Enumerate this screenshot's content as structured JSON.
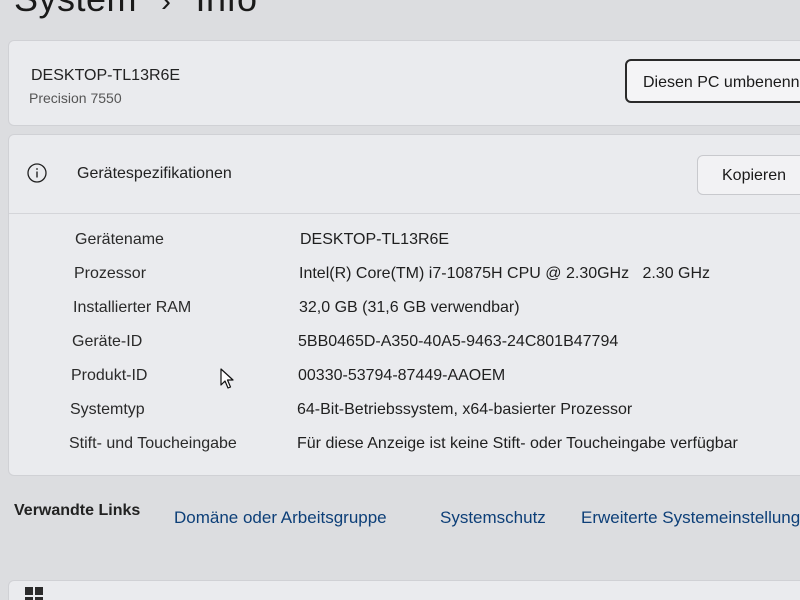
{
  "breadcrumb": {
    "parent": "System",
    "separator": "›",
    "current": "Info"
  },
  "device": {
    "name": "DESKTOP-TL13R6E",
    "model": "Precision 7550",
    "rename_button": "Diesen PC umbenennen"
  },
  "specs": {
    "title": "Gerätespezifikationen",
    "copy_button": "Kopieren",
    "rows": [
      {
        "label": "Gerätename",
        "value": "DESKTOP-TL13R6E"
      },
      {
        "label": "Prozessor",
        "value": "Intel(R) Core(TM) i7-10875H CPU @ 2.30GHz   2.30 GHz"
      },
      {
        "label": "Installierter RAM",
        "value": "32,0 GB (31,6 GB verwendbar)"
      },
      {
        "label": "Geräte-ID",
        "value": "5BB0465D-A350-40A5-9463-24C801B47794"
      },
      {
        "label": "Produkt-ID",
        "value": "00330-53794-87449-AAOEM"
      },
      {
        "label": "Systemtyp",
        "value": "64-Bit-Betriebssystem, x64-basierter Prozessor"
      },
      {
        "label": "Stift- und Toucheingabe",
        "value": "Für diese Anzeige ist keine Stift- oder Toucheingabe verfügbar"
      }
    ]
  },
  "related": {
    "title": "Verwandte Links",
    "links": [
      "Domäne oder Arbeitsgruppe",
      "Systemschutz",
      "Erweiterte Systemeinstellungen"
    ]
  },
  "icons": {
    "info": "info-icon",
    "windows": "windows-logo-icon",
    "cursor": "mouse-pointer-icon"
  },
  "colors": {
    "background": "#dcdde0",
    "card": "#eaebee",
    "link": "#0d3f78"
  }
}
